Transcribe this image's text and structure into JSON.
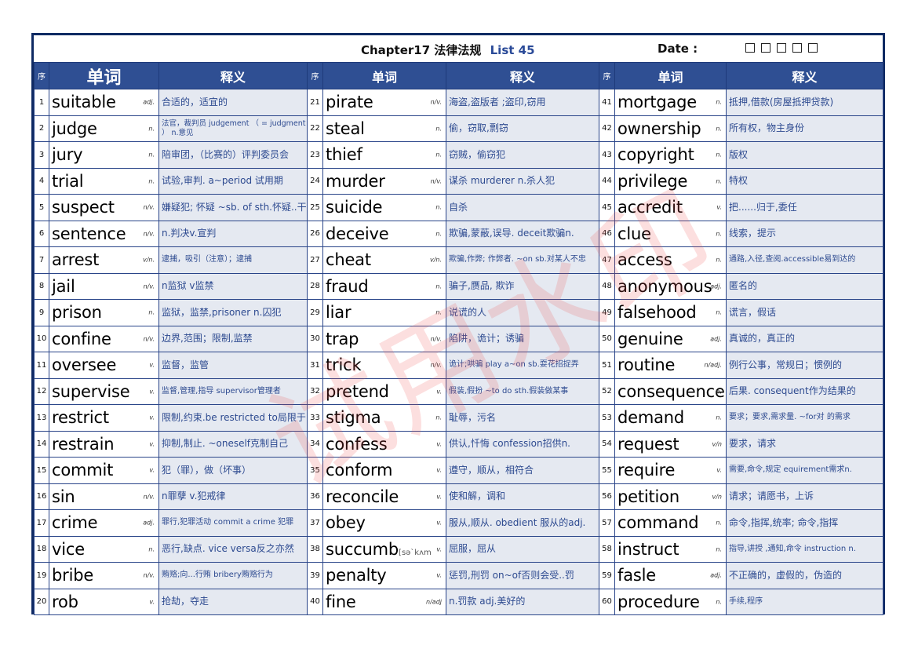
{
  "header": {
    "chapter": "Chapter17 法律法规",
    "list": "List 45",
    "date_label": "Date :",
    "date_boxes": 5
  },
  "columns": {
    "seq": "序",
    "word": "单词",
    "definition": "释义"
  },
  "watermark": "试用水印",
  "colors": {
    "frame": "#0f2a63",
    "header_bg": "#2f4f93",
    "definition_bg": "#e5e9f1",
    "definition_text": "#2d4a90",
    "list_accent": "#2a4a98",
    "watermark": "#f05050"
  },
  "entries": [
    {
      "n": "1",
      "word": "suitable",
      "pos": "adj.",
      "def": "合适的，适宜的"
    },
    {
      "n": "2",
      "word": "judge",
      "pos": "n.",
      "def": "法官，裁判员 judgement （ = judgment ） n.意见"
    },
    {
      "n": "3",
      "word": "jury",
      "pos": "n.",
      "def": "陪审团，（比赛的）评判委员会"
    },
    {
      "n": "4",
      "word": "trial",
      "pos": "n.",
      "def": "试验,审判. a~period 试用期"
    },
    {
      "n": "5",
      "word": "suspect",
      "pos": "n/v.",
      "def": "嫌疑犯; 怀疑 ~sb. of sth.怀疑..干.."
    },
    {
      "n": "6",
      "word": "sentence",
      "pos": "n/v.",
      "def": "n.判决v.宣判"
    },
    {
      "n": "7",
      "word": "arrest",
      "pos": "v/n.",
      "def": "逮捕，吸引（注意）；逮捕"
    },
    {
      "n": "8",
      "word": "jail",
      "pos": "n/v.",
      "def": "n监狱 v监禁"
    },
    {
      "n": "9",
      "word": "prison",
      "pos": "n.",
      "def": "监狱，监禁,prisoner n.囚犯"
    },
    {
      "n": "10",
      "word": "confine",
      "pos": "n/v.",
      "def": "边界,范围；限制,监禁"
    },
    {
      "n": "11",
      "word": "oversee",
      "pos": "v.",
      "def": "监督，监管"
    },
    {
      "n": "12",
      "word": "supervise",
      "pos": "v.",
      "def": "监督,管理,指导 supervisor管理者"
    },
    {
      "n": "13",
      "word": "restrict",
      "pos": "v.",
      "def": "限制,约束.be restricted to局限于"
    },
    {
      "n": "14",
      "word": "restrain",
      "pos": "v.",
      "def": "抑制,制止. ~oneself克制自己"
    },
    {
      "n": "15",
      "word": "commit",
      "pos": "v.",
      "def": "犯（罪），做（坏事）"
    },
    {
      "n": "16",
      "word": "sin",
      "pos": "n/v.",
      "def": "n罪孽  v.犯戒律"
    },
    {
      "n": "17",
      "word": "crime",
      "pos": "adj.",
      "def": "罪行,犯罪活动 commit a crime 犯罪"
    },
    {
      "n": "18",
      "word": "vice",
      "pos": "n.",
      "def": "恶行,缺点. vice versa反之亦然"
    },
    {
      "n": "19",
      "word": "bribe",
      "pos": "n/v.",
      "def": "贿赂;向...行贿 bribery贿赂行为"
    },
    {
      "n": "20",
      "word": "rob",
      "pos": "v.",
      "def": "抢劫，夺走"
    },
    {
      "n": "21",
      "word": "pirate",
      "pos": "n/v.",
      "def": "海盗,盗版者 ;盗印,窃用"
    },
    {
      "n": "22",
      "word": "steal",
      "pos": "n.",
      "def": "偷，窃取,剽窃"
    },
    {
      "n": "23",
      "word": "thief",
      "pos": "n.",
      "def": " 窃贼，偷窃犯"
    },
    {
      "n": "24",
      "word": "murder",
      "pos": "n/v.",
      "def": "谋杀 murderer n.杀人犯"
    },
    {
      "n": "25",
      "word": "suicide",
      "pos": "n.",
      "def": " 自杀"
    },
    {
      "n": "26",
      "word": "deceive",
      "pos": "n.",
      "def": "欺骗,蒙蔽,误导. deceit欺骗n."
    },
    {
      "n": "27",
      "word": "cheat",
      "pos": "v/n.",
      "def": "欺骗,作弊; 作弊者. ~on sb.对某人不忠"
    },
    {
      "n": "28",
      "word": "fraud",
      "pos": "n.",
      "def": "骗子,赝品, 欺诈"
    },
    {
      "n": "29",
      "word": "liar",
      "pos": "n.",
      "def": "说谎的人"
    },
    {
      "n": "30",
      "word": "trap",
      "pos": "n/v.",
      "def": "陷阱，诡计；诱骗"
    },
    {
      "n": "31",
      "word": "trick",
      "pos": "n/v.",
      "def": "诡计;哄骗 play a~on sb.耍花招捉弄"
    },
    {
      "n": "32",
      "word": "pretend",
      "pos": "v.",
      "def": "假装,假扮 ~to do sth.假装做某事"
    },
    {
      "n": "33",
      "word": "stigma",
      "pos": "n.",
      "def": "耻辱，污名"
    },
    {
      "n": "34",
      "word": "confess",
      "pos": "v.",
      "def": "供认,忏悔 confession招供n."
    },
    {
      "n": "35",
      "word": "conform",
      "pos": "v.",
      "def": "遵守，顺从，相符合"
    },
    {
      "n": "36",
      "word": "reconcile",
      "pos": "v.",
      "def": "使和解，调和"
    },
    {
      "n": "37",
      "word": "obey",
      "pos": "v.",
      "def": "服从,顺从. obedient 服从的adj."
    },
    {
      "n": "38",
      "word": "succumb",
      "phonetic": "[sə`kʌm",
      "pos": "v.",
      "def": "屈服，屈从"
    },
    {
      "n": "39",
      "word": "penalty",
      "pos": "v.",
      "def": "惩罚,刑罚  on~of否则会受..罚"
    },
    {
      "n": "40",
      "word": "fine",
      "pos": "n/adj",
      "def": "n.罚款 adj.美好的"
    },
    {
      "n": "41",
      "word": "mortgage",
      "pos": "n.",
      "def": "抵押,借款(房屋抵押贷款)"
    },
    {
      "n": "42",
      "word": "ownership",
      "pos": "n.",
      "def": "所有权，物主身份"
    },
    {
      "n": "43",
      "word": "copyright",
      "pos": "n.",
      "def": "版权"
    },
    {
      "n": "44",
      "word": "privilege",
      "pos": "n.",
      "def": "特权"
    },
    {
      "n": "45",
      "word": "accredit",
      "pos": "v.",
      "def": "把......归于,委任"
    },
    {
      "n": "46",
      "word": "clue",
      "pos": "n.",
      "def": "线索，提示"
    },
    {
      "n": "47",
      "word": "access",
      "pos": "n.",
      "def": "通路,入径,查阅.accessible易到达的"
    },
    {
      "n": "48",
      "word": "anonymous",
      "pos": "adj.",
      "def": " 匿名的"
    },
    {
      "n": "49",
      "word": "falsehood",
      "pos": "n.",
      "def": "谎言，假话"
    },
    {
      "n": "50",
      "word": "genuine",
      "pos": "adj.",
      "def": "真诚的，真正的"
    },
    {
      "n": "51",
      "word": "routine",
      "pos": "n/adj.",
      "def": "例行公事，常规日；惯例的"
    },
    {
      "n": "52",
      "word": "consequence",
      "pos": "n.",
      "def": "后果. consequent作为结果的"
    },
    {
      "n": "53",
      "word": "demand",
      "pos": "n.",
      "def": "要求；要求,需求量. ~for对 的需求"
    },
    {
      "n": "54",
      "word": "request",
      "pos": "v/n",
      "def": "要求，请求"
    },
    {
      "n": "55",
      "word": "require",
      "pos": "v.",
      "def": "需要,命令,规定 equirement需求n."
    },
    {
      "n": "56",
      "word": "petition",
      "pos": "v/n",
      "def": "请求；请愿书，上诉"
    },
    {
      "n": "57",
      "word": "command",
      "pos": "n.",
      "def": "命令,指挥,统率; 命令,指挥"
    },
    {
      "n": "58",
      "word": "instruct",
      "pos": "n.",
      "def": "指导,讲授 ,通知,命令 instruction n."
    },
    {
      "n": "59",
      "word": "fasle",
      "pos": "adj.",
      "def": "不正确的，虚假的，伪造的"
    },
    {
      "n": "60",
      "word": "procedure",
      "pos": "n.",
      "def": "手续,程序"
    }
  ]
}
